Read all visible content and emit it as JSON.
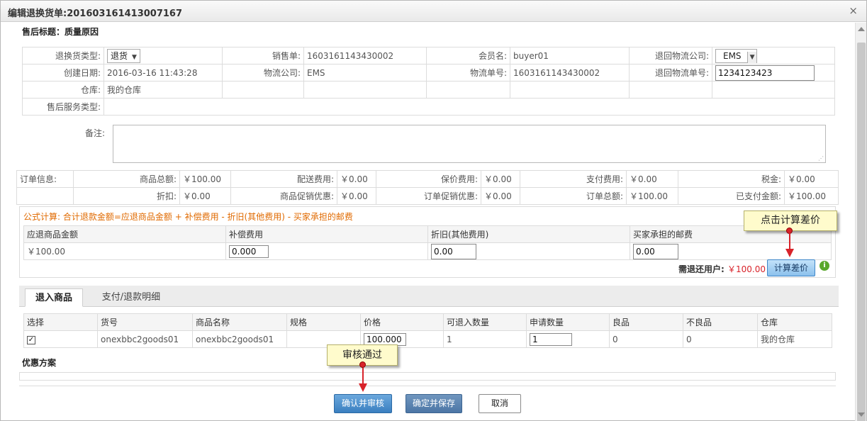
{
  "window": {
    "title": "编辑退换货单:201603161413007167",
    "close_label": "×"
  },
  "after_sales": {
    "label": "售后标题：",
    "value": "质量原因"
  },
  "info": {
    "return_type_label": "退换货类型:",
    "return_type_value": "退货",
    "sales_order_label": "销售单:",
    "sales_order_value": "1603161143430002",
    "member_label": "会员名:",
    "member_value": "buyer01",
    "return_logistics_label": "退回物流公司:",
    "return_logistics_value": "EMS",
    "created_label": "创建日期:",
    "created_value": "2016-03-16 11:43:28",
    "logistics_label": "物流公司:",
    "logistics_value": "EMS",
    "tracking_label": "物流单号:",
    "tracking_value": "1603161143430002",
    "return_tracking_label": "退回物流单号:",
    "return_tracking_value": "1234123423",
    "warehouse_label": "仓库:",
    "warehouse_value": "我的仓库",
    "service_type_label": "售后服务类型:"
  },
  "remark": {
    "label": "备注:",
    "value": ""
  },
  "order_info": {
    "label": "订单信息:",
    "goods_total_label": "商品总额:",
    "goods_total_value": "￥100.00",
    "shipping_label": "配送费用:",
    "shipping_value": "￥0.00",
    "insurance_label": "保价费用:",
    "insurance_value": "￥0.00",
    "payment_fee_label": "支付费用:",
    "payment_fee_value": "￥0.00",
    "tax_label": "税金:",
    "tax_value": "￥0.00",
    "discount_label": "折扣:",
    "discount_value": "￥0.00",
    "goods_promo_label": "商品促销优惠:",
    "goods_promo_value": "￥0.00",
    "order_promo_label": "订单促销优惠:",
    "order_promo_value": "￥0.00",
    "order_total_label": "订单总额:",
    "order_total_value": "￥100.00",
    "paid_label": "已支付金额:",
    "paid_value": "￥100.00"
  },
  "formula": {
    "text": "公式计算: 合计退款金额=应退商品金额 + 补偿费用 - 折旧(其他费用) - 买家承担的邮费",
    "headers": [
      "应退商品金额",
      "补偿费用",
      "折旧(其他费用)",
      "买家承担的邮费"
    ],
    "refund_goods_value": "￥100.00",
    "compensation_value": "0.000",
    "depreciation_value": "0.00",
    "buyer_postage_value": "0.00",
    "refund_label": "需退还用户:",
    "refund_value": "￥100.00",
    "calc_button": "计算差价",
    "info_icon": "i"
  },
  "tabs": [
    "退入商品",
    "支付/退款明细"
  ],
  "goods_table": {
    "headers": [
      "选择",
      "货号",
      "商品名称",
      "规格",
      "价格",
      "可退入数量",
      "申请数量",
      "良品",
      "不良品",
      "仓库"
    ],
    "row": {
      "checked": "✓",
      "sku": "onexbbc2goods01",
      "name": "onexbbc2goods01",
      "spec": "",
      "price": "100.000",
      "returnable_qty": "1",
      "apply_qty": "1",
      "good": "0",
      "defective": "0",
      "warehouse": "我的仓库"
    }
  },
  "promo": {
    "label": "优惠方案"
  },
  "buttons": {
    "confirm_audit": "确认并审核",
    "confirm_save": "确定并保存",
    "cancel": "取消"
  },
  "callouts": {
    "calc": "点击计算差价",
    "audit": "审核通过"
  },
  "colors": {
    "accent_red": "#d8232a",
    "formula_orange": "#e06a00",
    "primary_blue": "#3a7fc0"
  }
}
